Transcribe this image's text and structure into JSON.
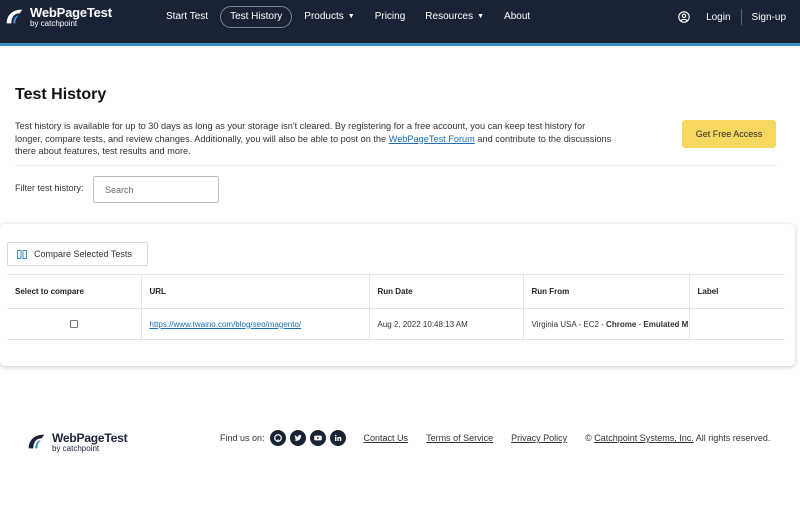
{
  "brand": {
    "title": "WebPageTest",
    "subtitle": "by catchpoint"
  },
  "nav": {
    "items": [
      {
        "label": "Start Test"
      },
      {
        "label": "Test History"
      },
      {
        "label": "Products"
      },
      {
        "label": "Pricing"
      },
      {
        "label": "Resources"
      },
      {
        "label": "About"
      }
    ],
    "login": "Login",
    "signup": "Sign-up"
  },
  "page": {
    "title": "Test History",
    "intro_before": "Test history is available for up to 30 days as long as your storage isn't cleared. By registering for a free account, you can keep test history for longer, compare tests, and review changes. Additionally, you will also be able to post on the ",
    "intro_link": "WebPageTest Forum",
    "intro_after": " and contribute to the discussions there about features, test results and more.",
    "free_access": "Get Free Access",
    "filter_label": "Filter test history:",
    "filter_placeholder": "Search"
  },
  "table": {
    "compare_button": "Compare Selected Tests",
    "headers": [
      "Select to compare",
      "URL",
      "Run Date",
      "Run From",
      "Label"
    ],
    "rows": [
      {
        "url": "https://www.twaino.com/blog/seo/magento/",
        "run_date": "Aug 2, 2022 10:48:13 AM",
        "run_from_location": "Virginia USA - EC2 - ",
        "run_from_browser": "Chrome",
        "run_from_sep": " - ",
        "run_from_device": "Emulated M",
        "label": ""
      }
    ]
  },
  "footer": {
    "find_us": "Find us on:",
    "socials": [
      "github-icon",
      "twitter-icon",
      "youtube-icon",
      "linkedin-icon"
    ],
    "contact": "Contact Us",
    "terms": "Terms of Service",
    "privacy": "Privacy Policy",
    "copy_prefix": "© ",
    "copy_link": "Catchpoint Systems, Inc.",
    "copy_suffix": " All rights reserved."
  },
  "colors": {
    "header_bg": "#1a2236",
    "accent_border": "#3c8ec7",
    "cta_yellow": "#f6d860",
    "link_blue": "#1a6fb5"
  }
}
